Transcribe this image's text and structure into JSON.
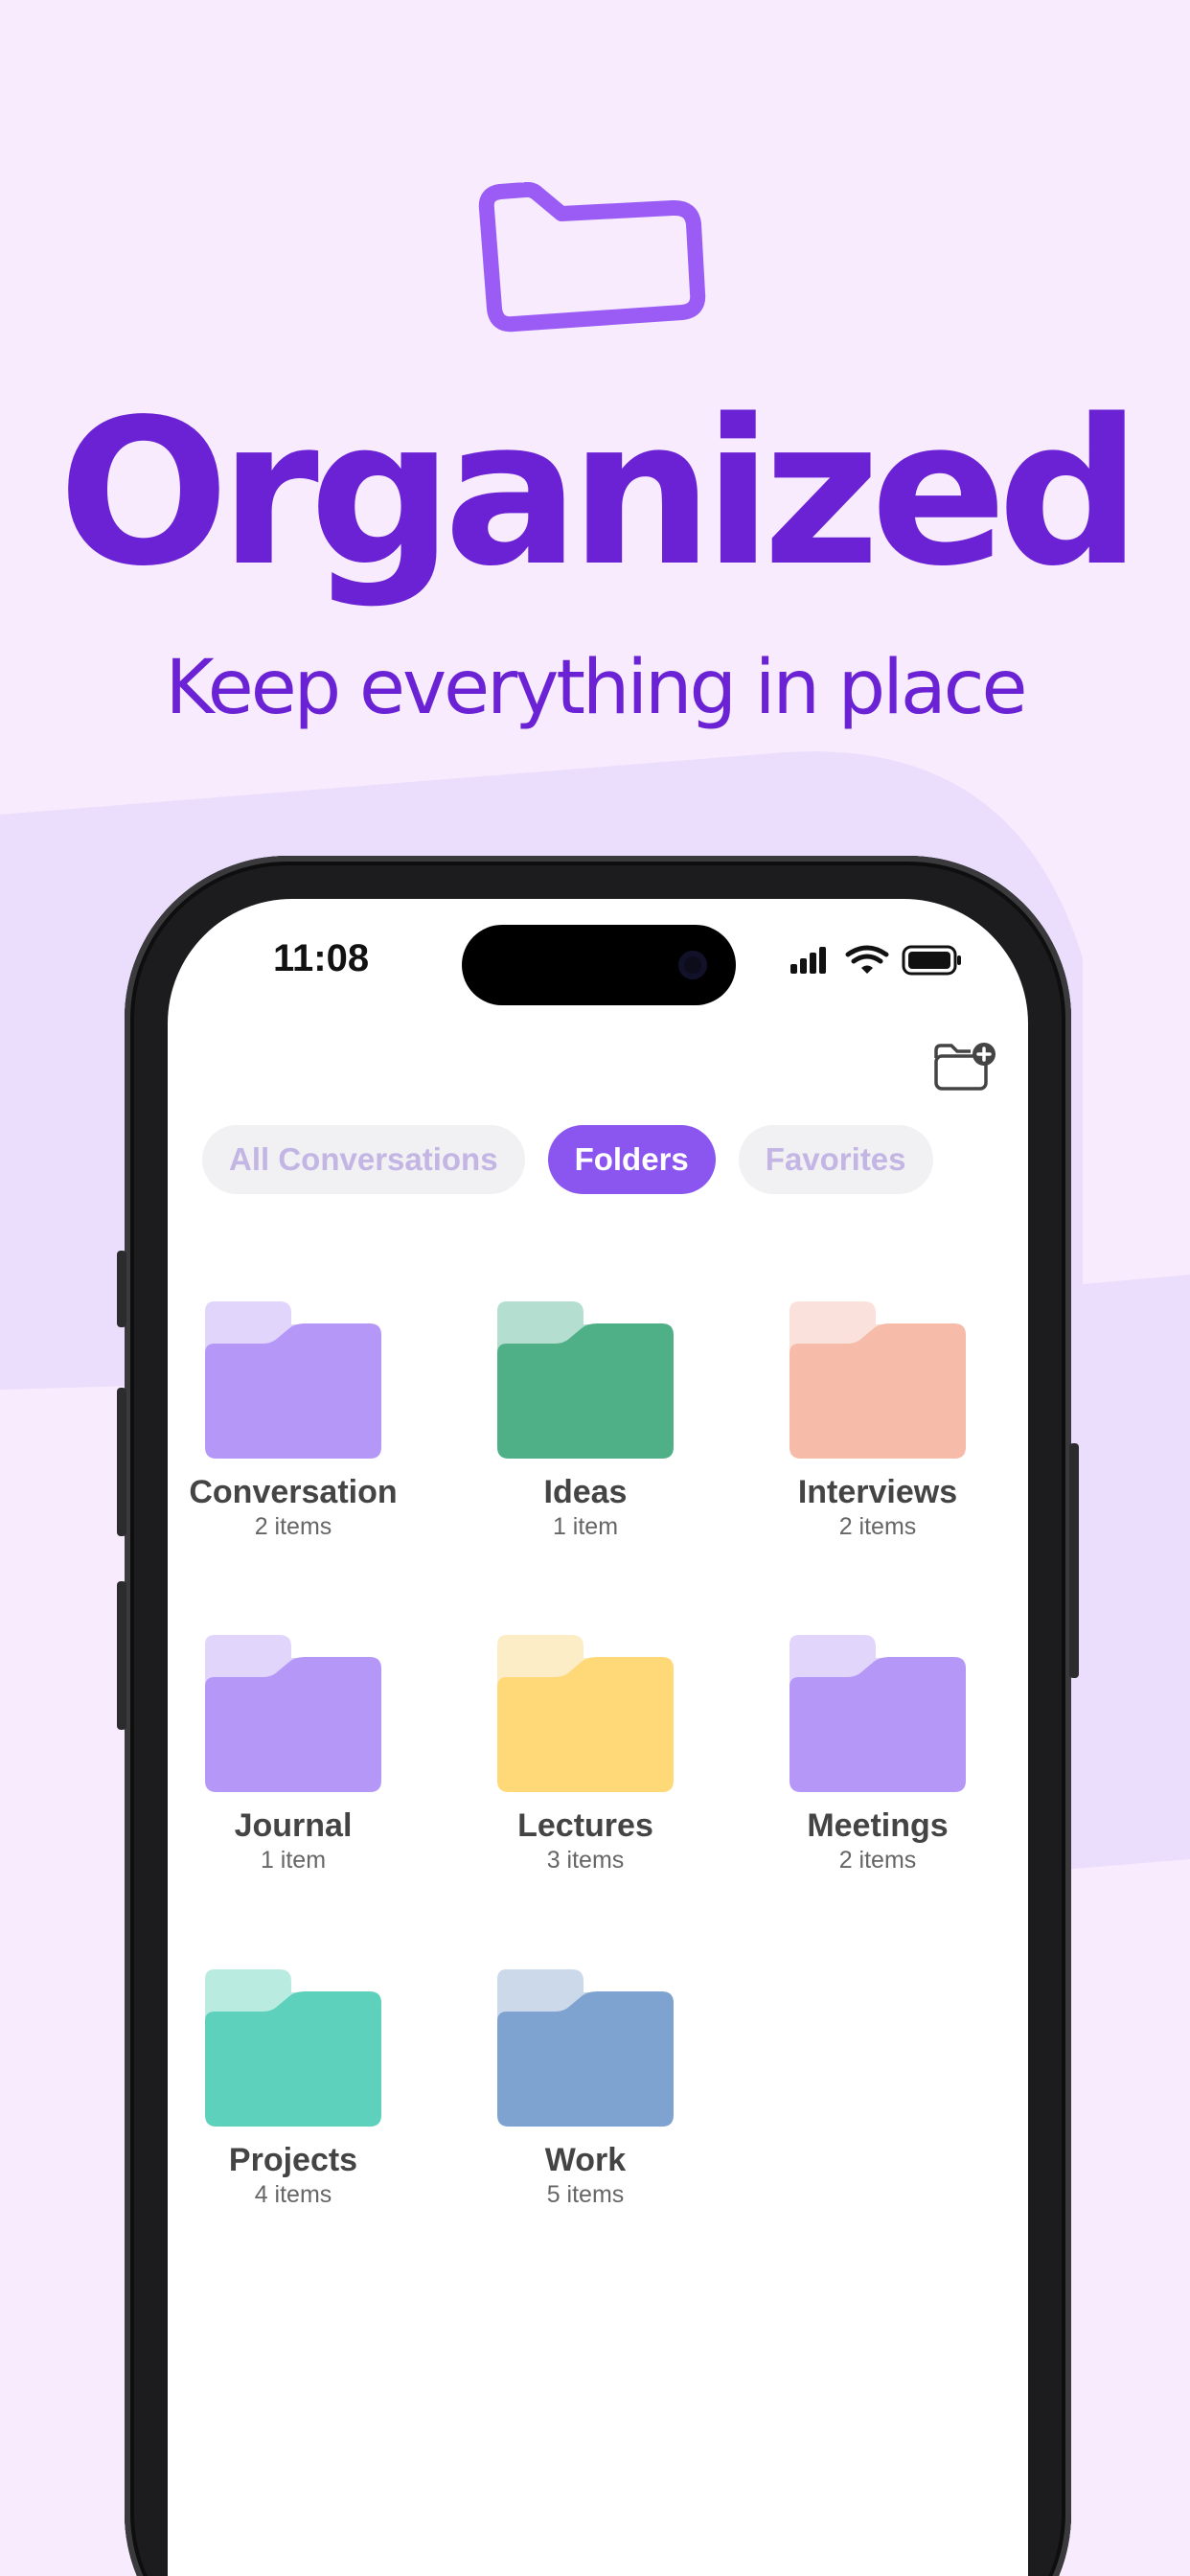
{
  "hero": {
    "title": "Organized",
    "subtitle": "Keep everything in place",
    "icon": "folder-outline-icon",
    "color": "#6a22d4"
  },
  "status_bar": {
    "time": "11:08",
    "icons": [
      "signal-icon",
      "wifi-icon",
      "battery-icon"
    ]
  },
  "toolbar": {
    "new_folder_icon": "new-folder-icon"
  },
  "tabs": [
    {
      "label": "All Conversations",
      "active": false
    },
    {
      "label": "Folders",
      "active": true
    },
    {
      "label": "Favorites",
      "active": false
    }
  ],
  "folders": [
    {
      "name": "Conversation",
      "count": "2 items",
      "back": "#e2d5fb",
      "front": "#b597f8"
    },
    {
      "name": "Ideas",
      "count": "1 item",
      "back": "#b4decf",
      "front": "#4fb088"
    },
    {
      "name": "Interviews",
      "count": "2 items",
      "back": "#fbe1db",
      "front": "#f7bba9"
    },
    {
      "name": "Journal",
      "count": "1 item",
      "back": "#e2d5fb",
      "front": "#b597f8"
    },
    {
      "name": "Lectures",
      "count": "3 items",
      "back": "#fdedc6",
      "front": "#ffd877"
    },
    {
      "name": "Meetings",
      "count": "2 items",
      "back": "#e2d5fb",
      "front": "#b597f8"
    },
    {
      "name": "Projects",
      "count": "4 items",
      "back": "#b9ebe1",
      "front": "#5ed1bd"
    },
    {
      "name": "Work",
      "count": "5 items",
      "back": "#ccd9ea",
      "front": "#7fa3d1"
    }
  ],
  "colors": {
    "accent": "#8b55f0",
    "background": "#f7ebfd",
    "band": "#ebddfc"
  }
}
